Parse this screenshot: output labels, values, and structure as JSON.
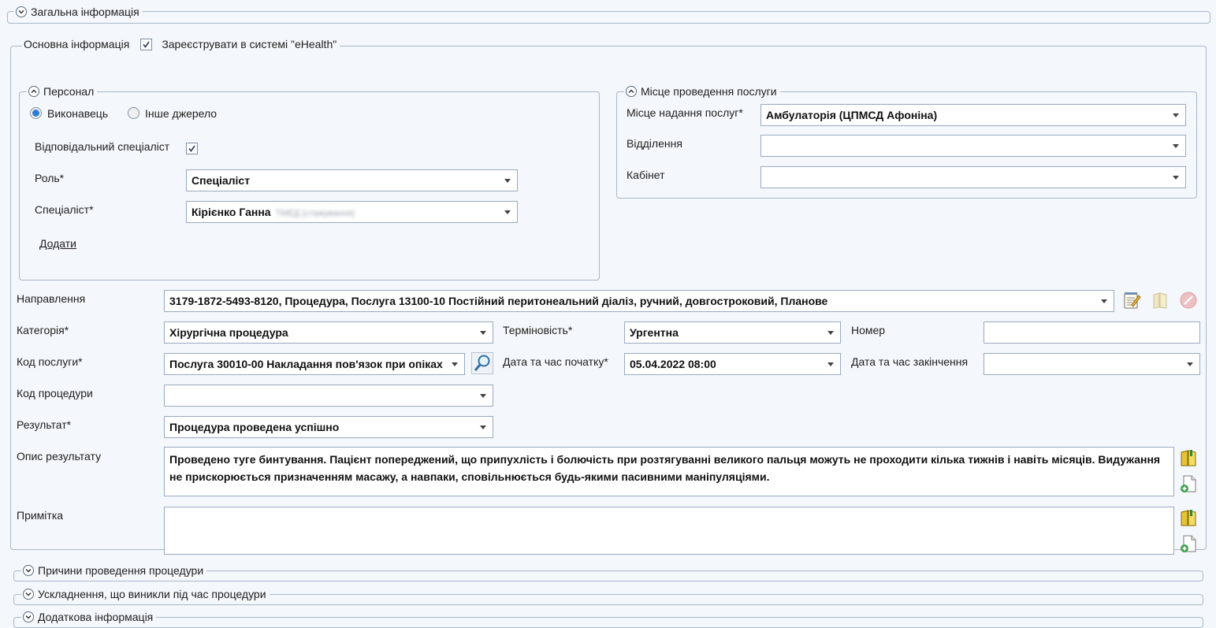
{
  "sections": {
    "general": "Загальна інформація",
    "reasons": "Причини проведення процедури",
    "complications": "Ускладнення, що виникли під час процедури",
    "additional": "Додаткова інформація"
  },
  "main": {
    "title": "Основна інформація",
    "ehealth_label": "Зареєструвати в системі \"eHealth\"",
    "ehealth_checked": true
  },
  "personnel": {
    "title": "Персонал",
    "radio_performer": "Виконавець",
    "radio_other": "Інше джерело",
    "responsible_label": "Відповідальний спеціаліст",
    "role_label": "Роль*",
    "role_value": "Спеціаліст",
    "specialist_label": "Спеціаліст*",
    "specialist_value": "Кірієнко Ганна",
    "specialist_hidden": "ТМЕД (стажування)",
    "add_link": "Додати"
  },
  "location": {
    "title": "Місце проведення послуги",
    "place_label": "Місце надання послуг*",
    "place_value": "Амбулаторія (ЦПМСД Афоніна)",
    "dept_label": "Відділення",
    "dept_value": "",
    "cabinet_label": "Кабінет",
    "cabinet_value": ""
  },
  "form": {
    "referral_label": "Направлення",
    "referral_value": "3179-1872-5493-8120, Процедура, Послуга 13100-10 Постійний перитонеальний діаліз, ручний, довгостроковий, Планове",
    "category_label": "Категорія*",
    "category_value": "Хірургічна процедура",
    "urgency_label": "Терміновість*",
    "urgency_value": "Ургентна",
    "number_label": "Номер",
    "number_value": "",
    "service_code_label": "Код послуги*",
    "service_code_value": "Послуга 30010-00 Накладання пов'язок при опіках",
    "start_label": "Дата та час початку*",
    "start_value": "05.04.2022 08:00",
    "end_label": "Дата та час закінчення",
    "end_value": "",
    "procedure_code_label": "Код процедури",
    "procedure_code_value": "",
    "result_label": "Результат*",
    "result_value": "Процедура проведена успішно",
    "result_desc_label": "Опис результату",
    "result_desc_value": "Проведено туге бинтування. Пацієнт попереджений, що припухлість і болючість при розтягуванні великого пальця можуть не проходити кілька тижнів і навіть місяців. Видужання не прискорюється призначенням масажу, а навпаки, сповільнюється будь-якими пасивними маніпуляціями.",
    "note_label": "Примітка",
    "note_value": ""
  }
}
